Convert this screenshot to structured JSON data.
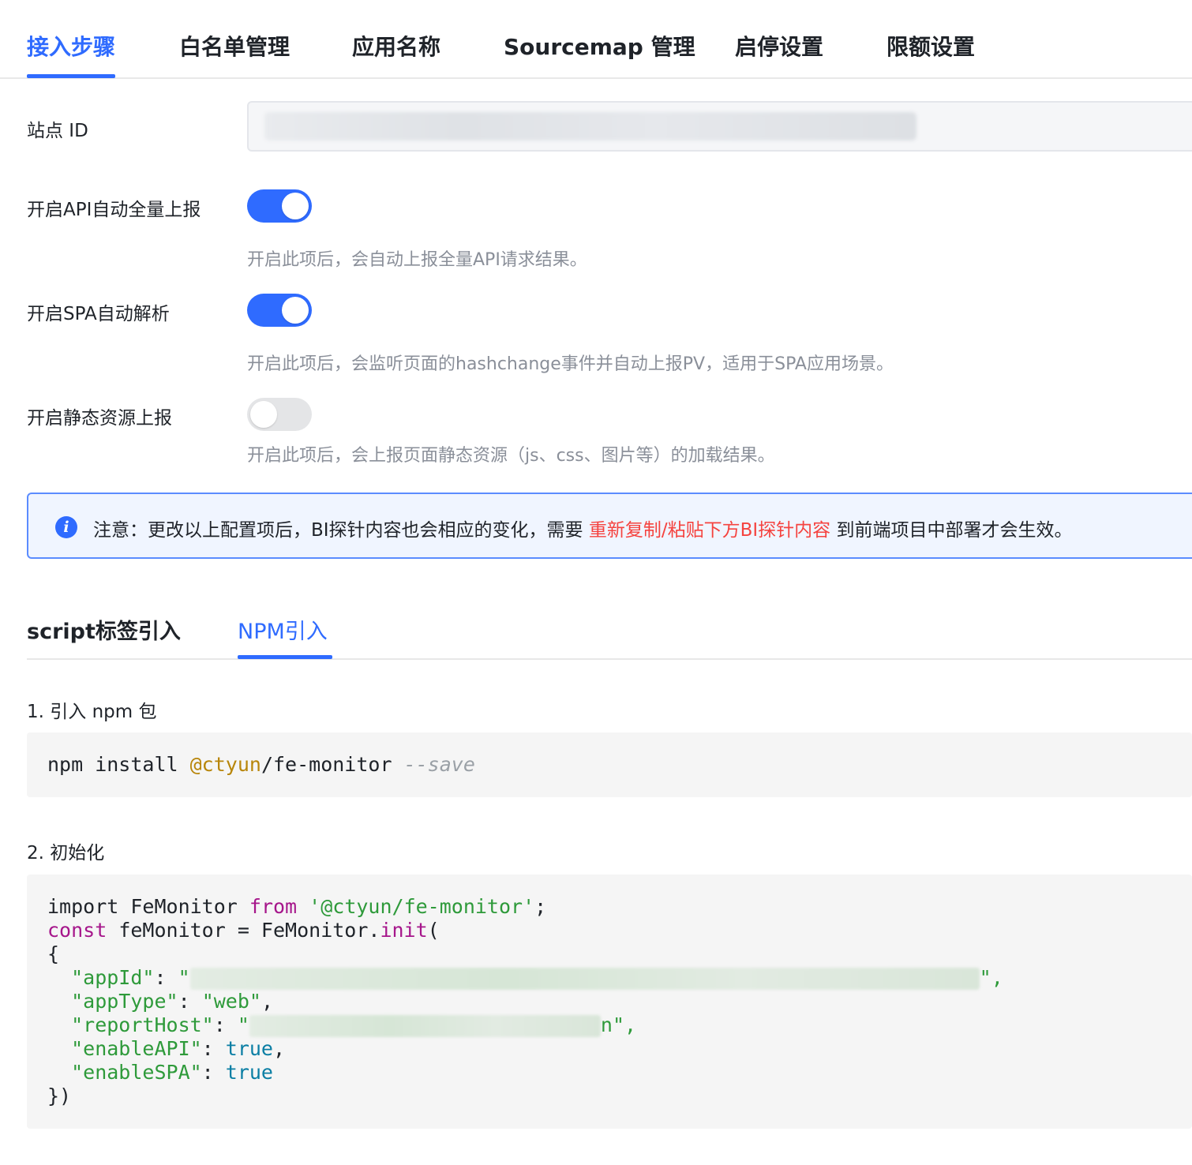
{
  "top_tabs": [
    {
      "label": "接入步骤",
      "active": true
    },
    {
      "label": "白名单管理"
    },
    {
      "label": "应用名称"
    },
    {
      "label": "Sourcemap 管理"
    },
    {
      "label": "启停设置"
    },
    {
      "label": "限额设置"
    }
  ],
  "form": {
    "site_id_label": "站点 ID",
    "api_label": "开启API自动全量上报",
    "api_help": "开启此项后，会自动上报全量API请求结果。",
    "api_enabled": true,
    "spa_label": "开启SPA自动解析",
    "spa_help": "开启此项后，会监听页面的hashchange事件并自动上报PV，适用于SPA应用场景。",
    "spa_enabled": true,
    "static_label": "开启静态资源上报",
    "static_help": "开启此项后，会上报页面静态资源（js、css、图片等）的加载结果。",
    "static_enabled": false
  },
  "notice": {
    "prefix": "注意：更改以上配置项后，BI探针内容也会相应的变化，需要",
    "highlight": "重新复制/粘贴下方BI探针内容",
    "suffix": "到前端项目中部署才会生效。",
    "icon": "info-icon",
    "highlight_color": "#f5433f"
  },
  "sub_tabs": [
    {
      "label": "script标签引入"
    },
    {
      "label": "NPM引入",
      "active": true
    }
  ],
  "step1": {
    "title": "1. 引入 npm 包",
    "cmd": "npm install ",
    "scope": "@ctyun",
    "pkg": "/fe-monitor ",
    "flag": "--save"
  },
  "step2": {
    "title": "2. 初始化",
    "l1_kw": "import",
    "l1_name": " FeMonitor ",
    "l1_from": "from",
    "l1_str": " '@ctyun/fe-monitor'",
    "l1_end": ";",
    "l2_kw": "const",
    "l2_mid": " feMonitor = FeMonitor.",
    "l2_fn": "init",
    "l2_end": "(",
    "l3": "{",
    "appId_key": "  \"appId\"",
    "colon": ": ",
    "quote": "\"",
    "appId_tail": "\",",
    "appType_key": "  \"appType\"",
    "appType_val": "\"web\"",
    "comma": ",",
    "reportHost_key": "  \"reportHost\"",
    "reportHost_tail": "n\",",
    "enableAPI_key": "  \"enableAPI\"",
    "enableAPI_val": "true",
    "enableSPA_key": "  \"enableSPA\"",
    "enableSPA_val": "true",
    "close": "})"
  },
  "colors": {
    "primary": "#2f6bff",
    "highlight": "#f5433f"
  }
}
